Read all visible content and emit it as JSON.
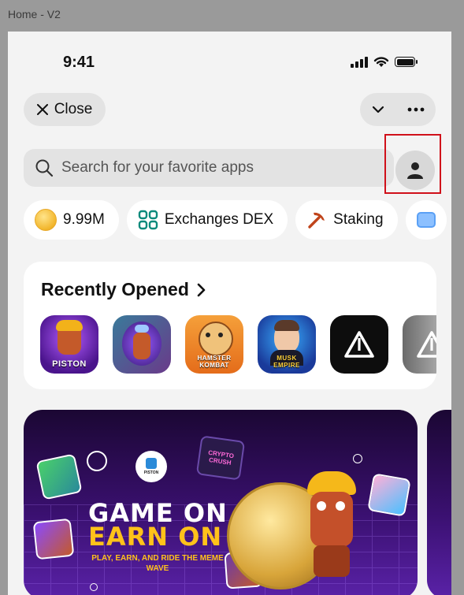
{
  "frame_label": "Home - V2",
  "status": {
    "time": "9:41"
  },
  "toolbar": {
    "close_label": "Close"
  },
  "search": {
    "placeholder": "Search for your favorite apps"
  },
  "chips": [
    {
      "label": "9.99M",
      "icon": "coin-icon"
    },
    {
      "label": "Exchanges DEX",
      "icon": "exchange-icon"
    },
    {
      "label": "Staking",
      "icon": "pickaxe-icon"
    }
  ],
  "recent": {
    "title": "Recently Opened",
    "apps": [
      {
        "name": "PISTON"
      },
      {
        "name": ""
      },
      {
        "name": "HAMSTER KOMBAT"
      },
      {
        "name": "MUSK EMPIRE"
      },
      {
        "name": ""
      },
      {
        "name": ""
      }
    ]
  },
  "banner": {
    "line1": "GAME ON",
    "line2": "EARN ON",
    "tagline": "PLAY, EARN, AND RIDE THE MEME WAVE",
    "logo_text": "PISTON",
    "sticker_text": "CRYPTO CRUSH"
  },
  "colors": {
    "accent_highlight": "#d0101a",
    "banner_yellow": "#ffc21a",
    "banner_purple": "#3a1070"
  }
}
